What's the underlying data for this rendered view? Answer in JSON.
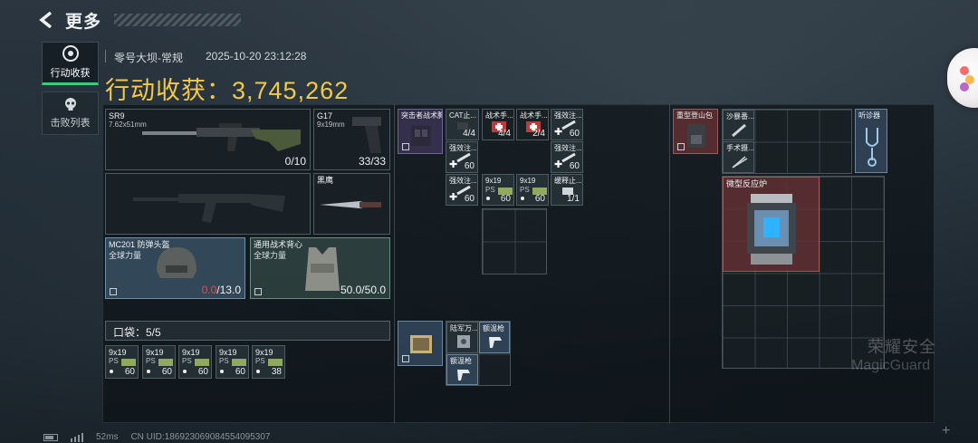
{
  "header": {
    "back_label": "更多"
  },
  "tabs": [
    {
      "label": "行动收获"
    },
    {
      "label": "击败列表"
    }
  ],
  "raid": {
    "map": "零号大坝-常规",
    "timestamp": "2025-10-20 23:12:28",
    "haul_label": "行动收获：",
    "haul_value": "3,745,262"
  },
  "equipment": {
    "primary": {
      "name": "SR9",
      "caliber": "7.62x51mm",
      "ammo": "0/10"
    },
    "pistol": {
      "name": "G17",
      "caliber": "9x19mm",
      "ammo": "33/33"
    },
    "melee": {
      "name": "黑鹰"
    },
    "helmet": {
      "name": "MC201 防弹头盔",
      "tier": "全球力量",
      "durability_current": "0.0",
      "durability_max": "/13.0"
    },
    "vest": {
      "name": "通用战术背心",
      "tier": "全球力量",
      "durability": "50.0/50.0"
    }
  },
  "pocket": {
    "label": "口袋：5/5",
    "items": [
      {
        "name": "9x19",
        "sub": "PS",
        "qty": "60"
      },
      {
        "name": "9x19",
        "sub": "PS",
        "qty": "60"
      },
      {
        "name": "9x19",
        "sub": "PS",
        "qty": "60"
      },
      {
        "name": "9x19",
        "sub": "PS",
        "qty": "60"
      },
      {
        "name": "9x19",
        "sub": "PS",
        "qty": "38"
      }
    ]
  },
  "rig": {
    "name": "突击者战术胸挂",
    "items": [
      {
        "name": "CAT止...",
        "qty": "4/4"
      },
      {
        "name": "战术手...",
        "qty": "4/4"
      },
      {
        "name": "战术手...",
        "qty": "2/4"
      },
      {
        "name": "强效注...",
        "qty": "60"
      },
      {
        "name": "强效注...",
        "qty": "60"
      },
      {
        "name": "强效注...",
        "qty": "60"
      },
      {
        "name": "强效注...",
        "qty": "60"
      },
      {
        "name": "9x19",
        "sub": "PS",
        "qty": "60"
      },
      {
        "name": "9x19",
        "sub": "PS",
        "qty": "60"
      },
      {
        "name": "缓释止...",
        "qty": "1/1"
      }
    ]
  },
  "secure": {
    "items": [
      {
        "name": "陆军万..."
      },
      {
        "name": "额温枪"
      },
      {
        "name": "额温枪"
      }
    ]
  },
  "backpack": {
    "name": "重型登山包",
    "items": [
      {
        "name": "沙暴番..."
      },
      {
        "name": "手术摄..."
      },
      {
        "name": "听诊器"
      },
      {
        "name": "微型反应炉"
      }
    ]
  },
  "watermark": {
    "cn": "荣耀安全",
    "en": "MagicGuard"
  },
  "status_bar": {
    "latency": "52ms",
    "uid": "CN UID:1869230690845540953​07"
  }
}
